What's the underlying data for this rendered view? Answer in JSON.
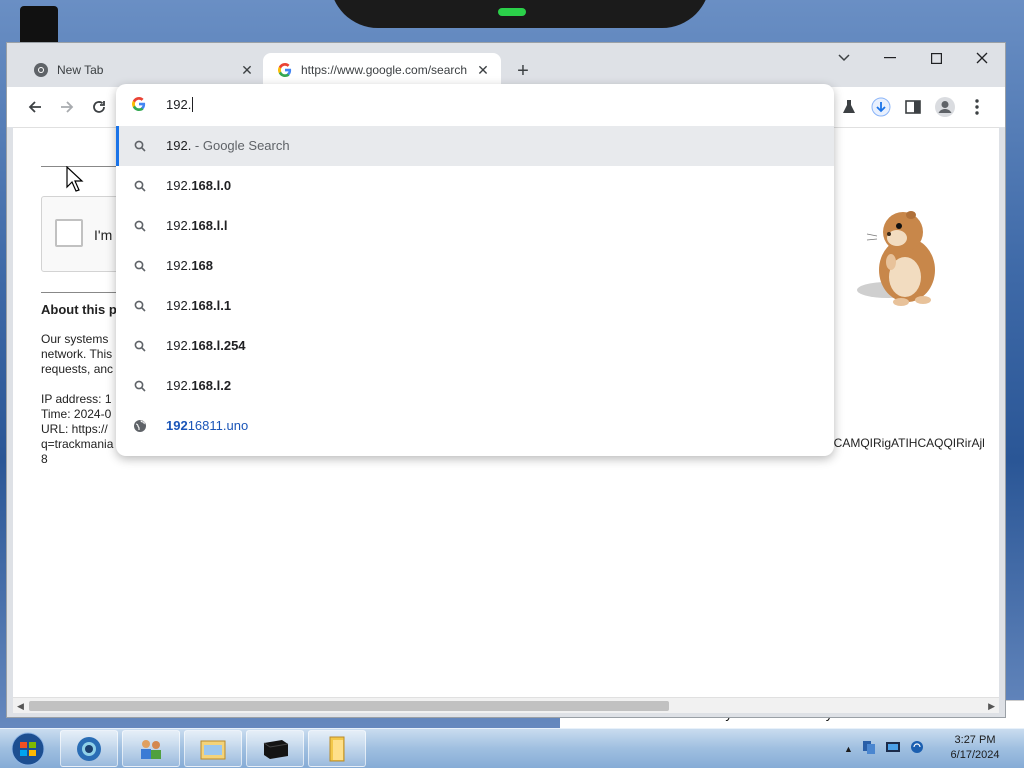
{
  "browser": {
    "tabs": [
      {
        "label": "New Tab",
        "favicon": "chrome-icon",
        "active": false
      },
      {
        "label": "https://www.google.com/search",
        "favicon": "google-icon",
        "active": true
      }
    ],
    "new_tab_label": "+",
    "window_controls": [
      "chevron-down-icon",
      "minimize-icon",
      "maximize-icon",
      "close-icon"
    ],
    "toolbar_icons": [
      "back-icon",
      "forward-icon",
      "reload-icon",
      "labs-icon",
      "download-icon",
      "side-panel-icon",
      "profile-icon",
      "menu-icon"
    ]
  },
  "omnibox": {
    "typed": "192.",
    "suggestions": [
      {
        "type": "search",
        "prefix": "192.",
        "bold": "",
        "suffix": " - Google Search",
        "selected": true
      },
      {
        "type": "search",
        "prefix": "192.",
        "bold": "168.l.0",
        "suffix": ""
      },
      {
        "type": "search",
        "prefix": "192.",
        "bold": "168.l.l",
        "suffix": ""
      },
      {
        "type": "search",
        "prefix": "192.",
        "bold": "168",
        "suffix": ""
      },
      {
        "type": "search",
        "prefix": "192.",
        "bold": "168.l.1",
        "suffix": ""
      },
      {
        "type": "search",
        "prefix": "192.",
        "bold": "168.l.254",
        "suffix": ""
      },
      {
        "type": "search",
        "prefix": "192.",
        "bold": "168.l.2",
        "suffix": ""
      },
      {
        "type": "url",
        "prefix": "192",
        "bold": "",
        "suffix": "16811.uno"
      }
    ]
  },
  "page": {
    "captcha_label": "I'm",
    "about_title": "About this p",
    "systems_lines": [
      "Our systems",
      "network. This",
      "requests, anc"
    ],
    "info_lines": [
      "IP address: 1",
      "Time: 2024-0",
      "URL: https://",
      "q=trackmania",
      "8"
    ],
    "url_tail": "hCAMQIRigATIHCAQQIRirAjl",
    "behind_window_text": "Need to find your Product Key?"
  },
  "taskbar": {
    "items": [
      "start-orb-icon",
      "browser-icon",
      "network-people-icon",
      "explorer-icon",
      "black-box-icon",
      "folder-icon"
    ],
    "clock_time": "3:27 PM",
    "clock_date": "6/17/2024"
  }
}
